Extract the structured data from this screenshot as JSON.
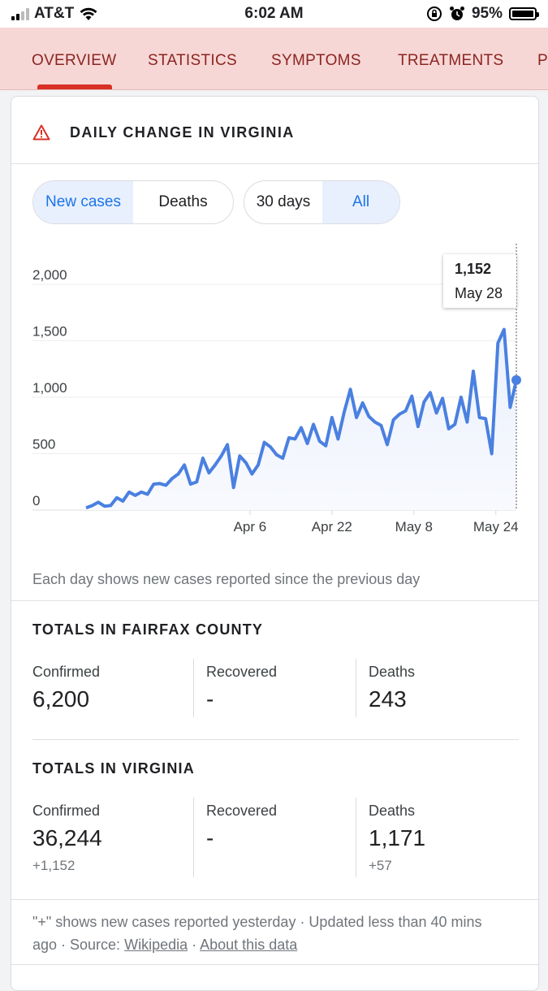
{
  "status_bar": {
    "carrier": "AT&T",
    "time": "6:02 AM",
    "battery": "95%"
  },
  "tabs": [
    {
      "label": "OVERVIEW",
      "selected": true
    },
    {
      "label": "STATISTICS"
    },
    {
      "label": "SYMPTOMS"
    },
    {
      "label": "TREATMENTS"
    },
    {
      "label": "P"
    }
  ],
  "card": {
    "title": "DAILY CHANGE IN VIRGINIA",
    "metric_toggle": [
      "New cases",
      "Deaths"
    ],
    "metric_selected": "New cases",
    "range_toggle": [
      "30 days",
      "All"
    ],
    "range_selected": "All",
    "tooltip": {
      "value": "1,152",
      "date": "May 28"
    },
    "note": "Each day shows new cases reported since the previous day"
  },
  "chart_data": {
    "type": "area",
    "x_start": "Mar 5",
    "x_ticks": [
      "Apr 6",
      "Apr 22",
      "May 8",
      "May 24"
    ],
    "y_ticks": [
      "0",
      "500",
      "1,000",
      "1,500",
      "2,000"
    ],
    "ylim": [
      0,
      2000
    ],
    "series_color": "#4a80e0",
    "values": [
      20,
      40,
      70,
      35,
      40,
      110,
      80,
      160,
      130,
      160,
      140,
      230,
      235,
      220,
      280,
      320,
      400,
      230,
      250,
      460,
      330,
      400,
      480,
      580,
      200,
      480,
      420,
      320,
      400,
      600,
      560,
      490,
      460,
      640,
      630,
      730,
      590,
      760,
      610,
      570,
      820,
      630,
      870,
      1070,
      820,
      950,
      830,
      780,
      750,
      580,
      800,
      850,
      880,
      1010,
      740,
      960,
      1040,
      860,
      990,
      720,
      760,
      1000,
      780,
      1230,
      820,
      810,
      500,
      1480,
      1600,
      910,
      1152
    ]
  },
  "fairfax": {
    "title": "TOTALS IN FAIRFAX COUNTY",
    "confirmed_label": "Confirmed",
    "confirmed": "6,200",
    "recovered_label": "Recovered",
    "recovered": "-",
    "deaths_label": "Deaths",
    "deaths": "243"
  },
  "virginia": {
    "title": "TOTALS IN VIRGINIA",
    "confirmed_label": "Confirmed",
    "confirmed": "36,244",
    "confirmed_delta": "+1,152",
    "recovered_label": "Recovered",
    "recovered": "-",
    "deaths_label": "Deaths",
    "deaths": "1,171",
    "deaths_delta": "+57"
  },
  "footer": {
    "text": "\"+\" shows new cases reported yesterday · Updated less than 40 mins ago · Source:",
    "source_link": "Wikipedia",
    "sep": "·",
    "about_link": "About this data"
  }
}
